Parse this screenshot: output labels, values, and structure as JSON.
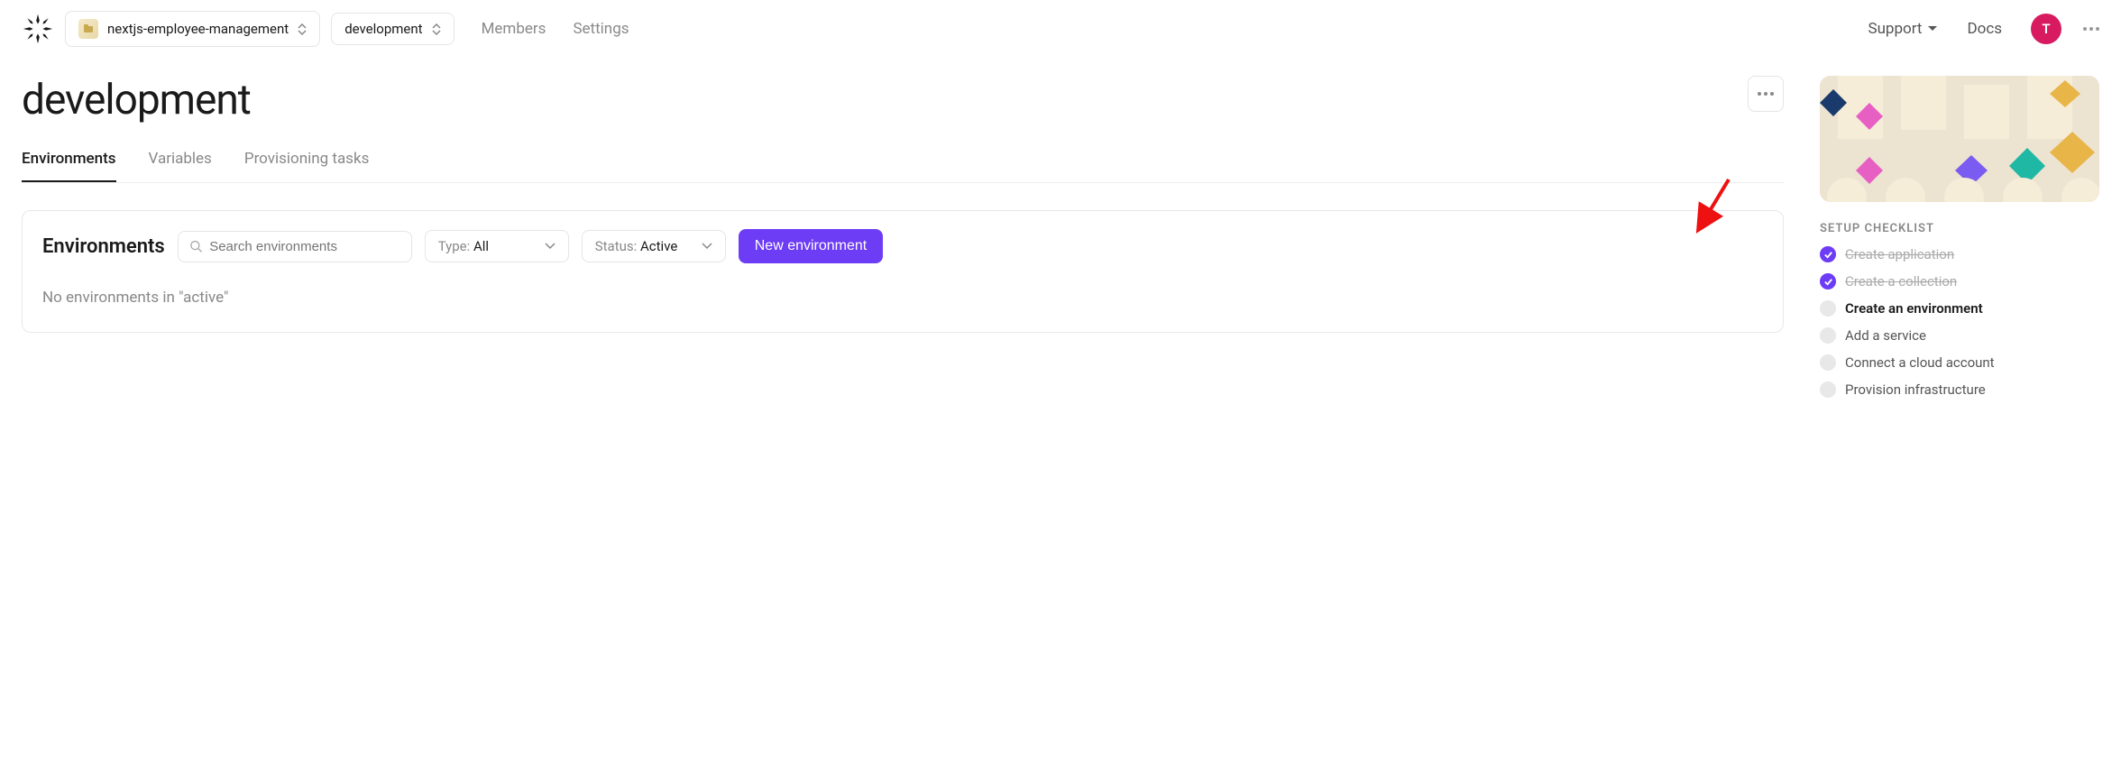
{
  "header": {
    "project_name": "nextjs-employee-management",
    "environment_name": "development",
    "nav": {
      "members": "Members",
      "settings": "Settings"
    },
    "support": "Support",
    "docs": "Docs",
    "avatar_initial": "T"
  },
  "page": {
    "title": "development",
    "tabs": {
      "environments": "Environments",
      "variables": "Variables",
      "provisioning": "Provisioning tasks"
    }
  },
  "panel": {
    "title": "Environments",
    "search_placeholder": "Search environments",
    "type_label": "Type:",
    "type_value": "All",
    "status_label": "Status:",
    "status_value": "Active",
    "new_button": "New environment",
    "empty_message": "No environments in \"active\""
  },
  "checklist": {
    "title": "SETUP CHECKLIST",
    "items": [
      {
        "label": "Create application",
        "done": true,
        "current": false
      },
      {
        "label": "Create a collection",
        "done": true,
        "current": false
      },
      {
        "label": "Create an environment",
        "done": false,
        "current": true
      },
      {
        "label": "Add a service",
        "done": false,
        "current": false
      },
      {
        "label": "Connect a cloud account",
        "done": false,
        "current": false
      },
      {
        "label": "Provision infrastructure",
        "done": false,
        "current": false
      }
    ]
  }
}
